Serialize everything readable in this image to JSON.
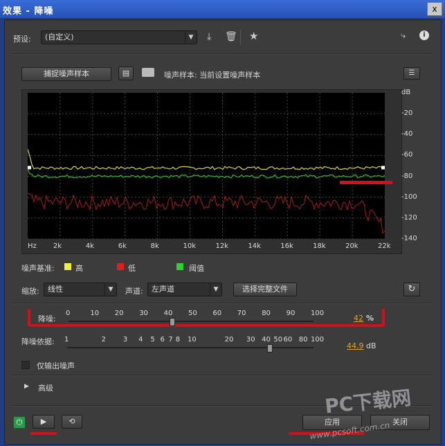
{
  "window": {
    "title": "效果 - 降噪",
    "close_label": "x"
  },
  "preset": {
    "label": "预设:",
    "value": "(自定义)"
  },
  "capture": {
    "button": "捕捉噪声样本",
    "sample_label": "噪声样本: 当前设置噪声样本"
  },
  "chart_data": {
    "type": "line",
    "x_ticks": [
      "Hz",
      "2k",
      "4k",
      "6k",
      "8k",
      "10k",
      "12k",
      "14k",
      "16k",
      "18k",
      "20k",
      "22k"
    ],
    "y_ticks": [
      "dB",
      "-20",
      "-40",
      "-60",
      "-80",
      "-100",
      "-120",
      "-140"
    ],
    "ylim": [
      -140,
      0
    ],
    "xlim": [
      0,
      22000
    ],
    "series": [
      {
        "name": "高",
        "color": "#f0f040",
        "level": -72
      },
      {
        "name": "低",
        "color": "#e02020",
        "level": -105
      },
      {
        "name": "阈值",
        "color": "#30d030",
        "level": -80
      }
    ]
  },
  "legend": {
    "title": "噪声基准:",
    "high": "高",
    "low": "低",
    "threshold": "阈值",
    "colors": {
      "high": "#f0f040",
      "low": "#e02020",
      "threshold": "#30d030"
    }
  },
  "scale": {
    "label": "缩放:",
    "value": "线性"
  },
  "channel": {
    "label": "声道:",
    "value": "左声道"
  },
  "select_file": "选择完整文件",
  "reduce": {
    "label": "降噪:",
    "ticks": [
      "0",
      "10",
      "20",
      "30",
      "40",
      "50",
      "60",
      "70",
      "80",
      "90",
      "100"
    ],
    "value": "42",
    "unit": "%",
    "fraction": 0.42
  },
  "reduce_by": {
    "label": "降噪依据:",
    "ticks": [
      "1",
      "2",
      "3",
      "4",
      "5",
      "6",
      "7",
      "8",
      "10",
      "20",
      "30",
      "40",
      "50",
      "60",
      "80",
      "100"
    ],
    "value": "44.9",
    "unit": "dB"
  },
  "output_noise": "仅输出噪声",
  "advanced": "高级",
  "apply": "应用",
  "close": "关闭",
  "watermark": {
    "main": "PC下载网",
    "sub": "www.pcsoft.com.cn"
  }
}
